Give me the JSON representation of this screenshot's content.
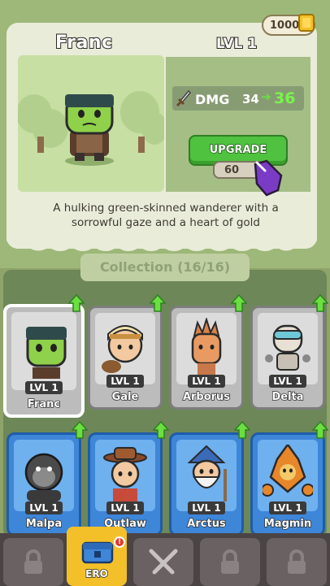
{
  "currency": {
    "amount": "1000",
    "icon": "gold-bar-icon",
    "color": "#f4c02a"
  },
  "hero": {
    "name": "Franc",
    "level": "LVL 1",
    "stat_label": "DMG",
    "stat_current": "34",
    "stat_next": "36",
    "upgrade_label": "UPGRADE",
    "upgrade_cost": "60",
    "description": "A hulking green-skinned wanderer with a sorrowful gaze and a heart of gold"
  },
  "collection": {
    "title": "Collection (16/16)",
    "heroes": [
      {
        "name": "Franc",
        "level": "LVL 1",
        "rarity": "common",
        "selected": true
      },
      {
        "name": "Gale",
        "level": "LVL 1",
        "rarity": "common"
      },
      {
        "name": "Arborus",
        "level": "LVL 1",
        "rarity": "common"
      },
      {
        "name": "Delta",
        "level": "LVL 1",
        "rarity": "common"
      },
      {
        "name": "Malpa",
        "level": "LVL 1",
        "rarity": "rare"
      },
      {
        "name": "Outlaw",
        "level": "LVL 1",
        "rarity": "rare"
      },
      {
        "name": "Arctus",
        "level": "LVL 1",
        "rarity": "rare"
      },
      {
        "name": "Magmin",
        "level": "LVL 1",
        "rarity": "rare"
      }
    ]
  },
  "nav": {
    "items": [
      {
        "label": "",
        "icon": "lock-icon"
      },
      {
        "label": "ERO",
        "icon": "hero-chest-icon",
        "active": true,
        "badge": "!"
      },
      {
        "label": "",
        "icon": "crossed-swords-icon"
      },
      {
        "label": "",
        "icon": "lock-icon"
      },
      {
        "label": "",
        "icon": "lock-icon"
      }
    ]
  },
  "colors": {
    "upgrade": "#4fc23f",
    "rare_tile": "#3e86d8",
    "common_tile": "#bcbcbc",
    "stat_up": "#7af44c"
  }
}
